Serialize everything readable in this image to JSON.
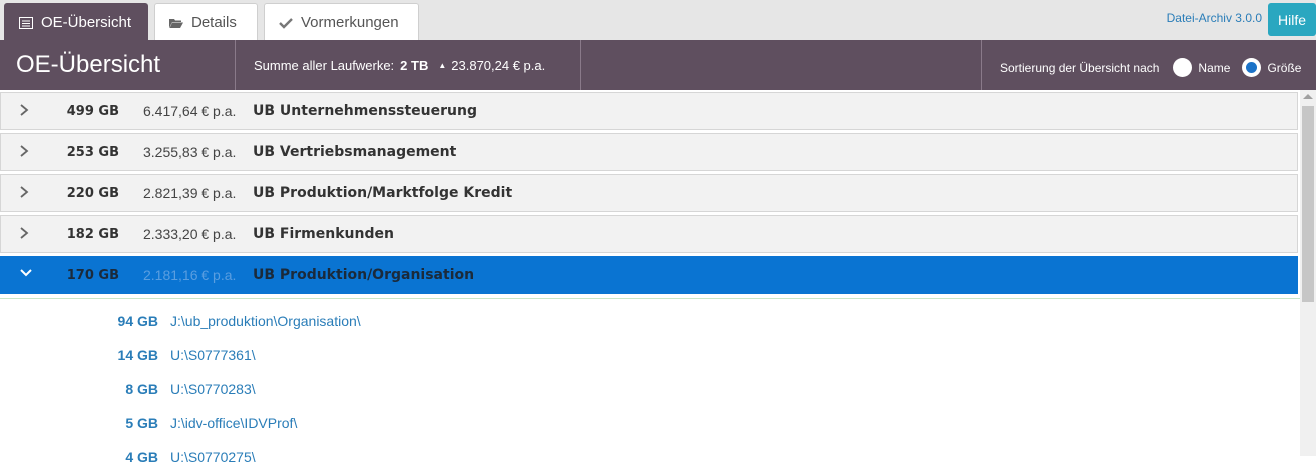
{
  "tabs": [
    {
      "label": "OE-Übersicht",
      "icon": "list-icon",
      "active": true
    },
    {
      "label": "Details",
      "icon": "folder-open-icon",
      "active": false
    },
    {
      "label": "Vormerkungen",
      "icon": "check-icon",
      "active": false
    }
  ],
  "app": {
    "version": "Datei-Archiv 3.0.0",
    "help_label": "Hilfe"
  },
  "header": {
    "title": "OE-Übersicht",
    "sum_label": "Summe aller Laufwerke:",
    "sum_size": "2 TB",
    "sum_cost": "23.870,24 € p.a.",
    "sort_label": "Sortierung der Übersicht nach",
    "sort_options": [
      {
        "label": "Name",
        "checked": false
      },
      {
        "label": "Größe",
        "checked": true
      }
    ]
  },
  "units": [
    {
      "size": "499 GB",
      "cost": "6.417,64 € p.a.",
      "name": "UB Unternehmenssteuerung",
      "expanded": false
    },
    {
      "size": "253 GB",
      "cost": "3.255,83 € p.a.",
      "name": "UB Vertriebsmanagement",
      "expanded": false
    },
    {
      "size": "220 GB",
      "cost": "2.821,39 € p.a.",
      "name": "UB Produktion/Marktfolge Kredit",
      "expanded": false
    },
    {
      "size": "182 GB",
      "cost": "2.333,20 € p.a.",
      "name": "UB Firmenkunden",
      "expanded": false
    },
    {
      "size": "170 GB",
      "cost": "2.181,16 € p.a.",
      "name": "UB Produktion/Organisation",
      "expanded": true
    }
  ],
  "paths": [
    {
      "size": "94 GB",
      "path": "J:\\ub_produktion\\Organisation\\"
    },
    {
      "size": "14 GB",
      "path": "U:\\S0777361\\"
    },
    {
      "size": "8 GB",
      "path": "U:\\S0770283\\"
    },
    {
      "size": "5 GB",
      "path": "J:\\idv-office\\IDVProf\\"
    },
    {
      "size": "4 GB",
      "path": "U:\\S0770275\\"
    }
  ],
  "colors": {
    "header": "#5f4f5f",
    "selected_row": "#0a74d2",
    "link": "#2a7db8",
    "help": "#2aa7c0"
  }
}
